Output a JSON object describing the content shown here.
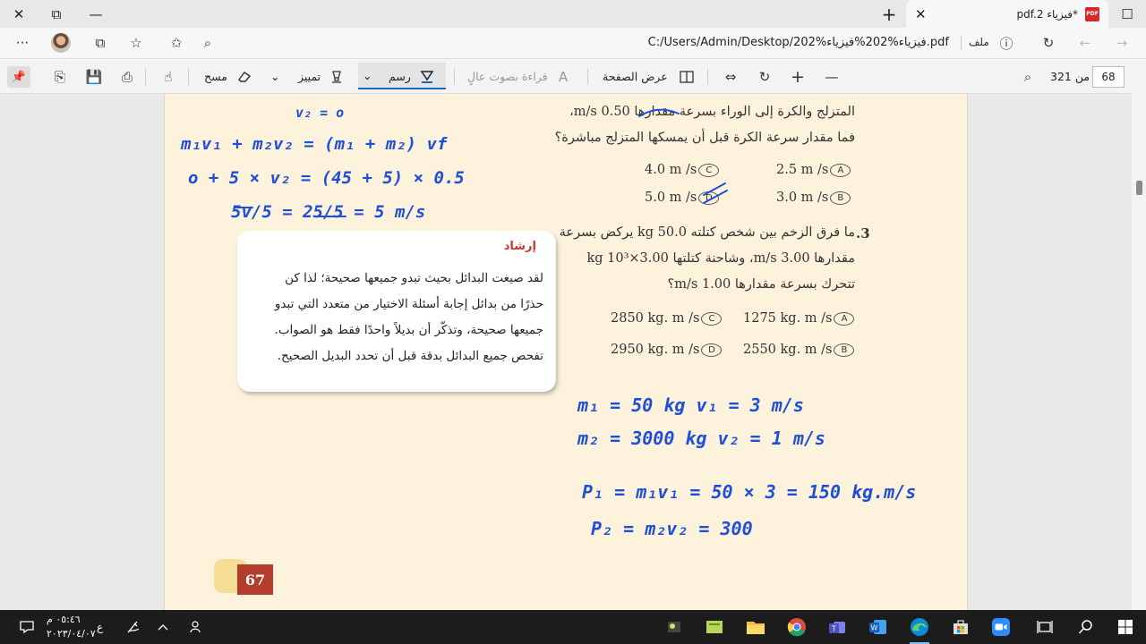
{
  "window": {
    "close_glyph": "✕",
    "restore_glyph": "⧉",
    "minimize_glyph": "—",
    "newtab_glyph": "+",
    "maximize_glyph": "☐"
  },
  "tab": {
    "title": "*فيزياء pdf.2",
    "close_glyph": "✕",
    "badge": "PDF"
  },
  "address": {
    "url": "C:/Users/Admin/Desktop/202%فيزياء%202%فيزياء.pdf",
    "file_label": "ملف",
    "info_glyph": "ⓘ",
    "more_glyph": "···",
    "collections_glyph": "⧉",
    "favorites_glyph": "☆",
    "addfav_glyph": "✩",
    "zoom_glyph": "⌕",
    "refresh_glyph": "↻",
    "back_glyph": "←",
    "forward_glyph": "→"
  },
  "pdf_toolbar": {
    "page_current": "68",
    "page_total_label": "من 321",
    "zoom_out": "—",
    "zoom_in": "+",
    "rotate_glyph": "↻",
    "fit_glyph": "⇔",
    "page_view_label": "عرض الصفحة",
    "read_aloud_label": "قراءة بصوت عالٍ",
    "read_aloud_glyph": "A",
    "draw_label": "رسم",
    "highlight_label": "تمييز",
    "erase_label": "مسح",
    "chevron": "⌄",
    "search_glyph": "⌕",
    "touch_glyph": "☝",
    "print_glyph": "⎙",
    "save_glyph": "💾",
    "saveas_glyph": "⎘",
    "pin_glyph": "📌"
  },
  "page": {
    "q2_line1": "المتزلج والكرة إلى الوراء بسرعة مقدارها 0.50 m/s،",
    "q2_line2": "فما مقدار سرعة الكرة قبل أن يمسكها المتزلج مباشرة؟",
    "q2_options": [
      {
        "letter": "A",
        "text": "2.5 m /s"
      },
      {
        "letter": "B",
        "text": "3.0 m /s"
      },
      {
        "letter": "C",
        "text": "4.0 m /s"
      },
      {
        "letter": "D",
        "text": "5.0 m /s"
      }
    ],
    "q3_number": ".3",
    "q3_line1": "ما فرق الزخم بين شخص كتلته 50.0 kg يركض بسرعة",
    "q3_line2": "مقدارها 3.00 m/s، وشاحنة كتلتها 3.00×10³ kg",
    "q3_line3": "تتحرك بسرعة مقدارها 1.00 m/s؟",
    "q3_options": [
      {
        "letter": "A",
        "text": "1275 kg. m /s"
      },
      {
        "letter": "B",
        "text": "2550 kg. m /s"
      },
      {
        "letter": "C",
        "text": "2850 kg. m /s"
      },
      {
        "letter": "D",
        "text": "2950 kg. m /s"
      }
    ],
    "hint_title": "إرشاد",
    "hint_lines": [
      "لقد صيغت البدائل بحيث تبدو جميعها صحيحة؛ لذا كن",
      "حذرًا من بدائل إجابة أسئلة الاختيار من متعدد التي تبدو",
      "جميعها صحيحة، وتذكّر أن بديلاً واحدًا فقط هو الصواب.",
      "تفحص جميع البدائل بدقة قبل أن تحدد البديل الصحيح."
    ],
    "handwriting": [
      "v₂ = o",
      "m₁v₁ + m₂v₂ = (m₁ + m₂) vf",
      "o + 5 × v₂ = (45 + 5) × 0.5",
      "5v/5 = 25/5 = 5 m/s",
      "m₁ = 50 kg     v₁ = 3 m/s",
      "m₂ = 3000 kg   v₂ = 1 m/s",
      "P₁ = m₁v₁ = 50 × 3 = 150 kg.m/s",
      "P₂ = m₂v₂ = 300"
    ],
    "ink_color": "#1f4fd8",
    "page_number": "67"
  },
  "taskbar": {
    "time": "٠٥:٤٦ م",
    "date": "٢٠٢٣/٠٤/٠٧",
    "lang": "ع",
    "accent_edge": "#0078d4"
  }
}
